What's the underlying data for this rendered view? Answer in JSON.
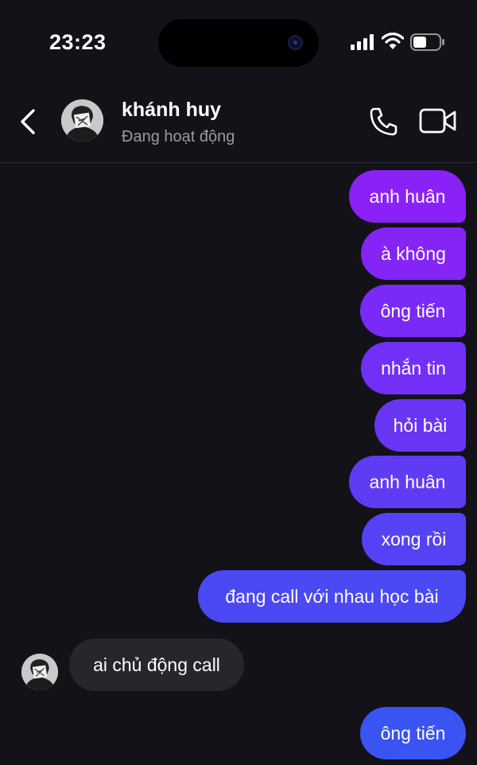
{
  "status_bar": {
    "time": "23:23"
  },
  "header": {
    "contact_name": "khánh huy",
    "contact_status": "Đang hoạt động"
  },
  "colors": {
    "background": "#121218",
    "incoming_bubble": "#26262d",
    "outgoing_gradient_top": "#8a22f7",
    "outgoing_gradient_bottom": "#3a53f3"
  },
  "messages": [
    {
      "sender": "me",
      "text": "anh huân"
    },
    {
      "sender": "me",
      "text": "à không"
    },
    {
      "sender": "me",
      "text": "ông tiến"
    },
    {
      "sender": "me",
      "text": "nhắn tin"
    },
    {
      "sender": "me",
      "text": "hỏi bài"
    },
    {
      "sender": "me",
      "text": "anh huân"
    },
    {
      "sender": "me",
      "text": "xong rồi"
    },
    {
      "sender": "me",
      "text": "đang call với nhau học bài"
    },
    {
      "sender": "them",
      "text": "ai chủ động call"
    },
    {
      "sender": "me",
      "text": "ông tiến"
    }
  ]
}
